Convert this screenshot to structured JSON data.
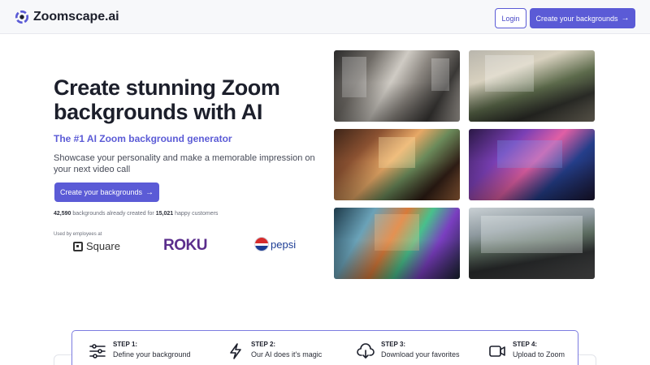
{
  "header": {
    "brand": "Zoomscape.ai",
    "login_label": "Login",
    "cta_label": "Create your backgrounds",
    "cta_arrow": "→"
  },
  "hero": {
    "title": "Create stunning Zoom backgrounds with AI",
    "tagline": "The #1 AI Zoom background generator",
    "description": "Showcase your personality and make a memorable impression on your next video call",
    "cta_label": "Create your backgrounds",
    "cta_arrow": "→",
    "stats": {
      "backgrounds_count": "42,590",
      "backgrounds_text": "backgrounds already created for",
      "customers_count": "15,021",
      "customers_text": "happy customers"
    },
    "used_by_label": "Used by employees at",
    "brands": [
      {
        "name": "Square",
        "icon": "square-logo-icon"
      },
      {
        "name": "ROKU",
        "icon": "roku-logo"
      },
      {
        "name": "pepsi",
        "icon": "pepsi-globe-icon"
      }
    ]
  },
  "gallery": {
    "images": [
      "modern-living-room",
      "mountain-view-lounge",
      "warm-wooden-interior",
      "neon-purple-room",
      "colorful-glass-room",
      "minimal-mountain-room"
    ]
  },
  "steps": [
    {
      "label": "STEP 1:",
      "text": "Define your background",
      "icon": "sliders-icon"
    },
    {
      "label": "STEP 2:",
      "text": "Our AI does it's magic",
      "icon": "lightning-icon"
    },
    {
      "label": "STEP 3:",
      "text": "Download your favorites",
      "icon": "cloud-download-icon"
    },
    {
      "label": "STEP 4:",
      "text": "Upload to Zoom",
      "icon": "video-camera-icon"
    }
  ],
  "colors": {
    "accent": "#5b5bd6",
    "text_dark": "#1c1f2b",
    "header_bg": "#f7f8fa"
  }
}
